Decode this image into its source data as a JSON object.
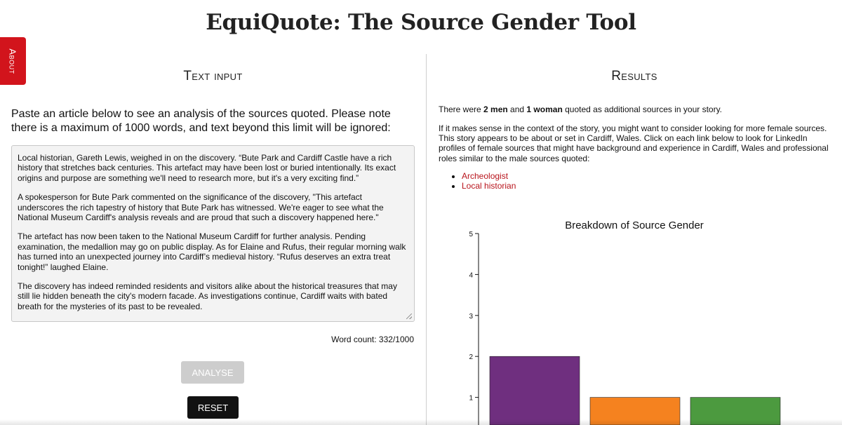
{
  "page": {
    "title": "EquiQuote: The Source Gender Tool"
  },
  "about_tab": {
    "label": "About"
  },
  "left": {
    "heading": "Text input",
    "instructions": "Paste an article below to see an analysis of the sources quoted. Please note there is a maximum of 1000 words, and text beyond this limit will be ignored:",
    "article_paragraphs": [
      "Local historian, Gareth Lewis, weighed in on the discovery. “Bute Park and Cardiff Castle have a rich history that stretches back centuries. This artefact may have been lost or buried intentionally. Its exact origins and purpose are something we'll need to research more, but it's a very exciting find.”",
      "A spokesperson for Bute Park commented on the significance of the discovery, \"This artefact underscores the rich tapestry of history that Bute Park has witnessed. We're eager to see what the National Museum Cardiff's analysis reveals and are proud that such a discovery happened here.\"",
      "The artefact has now been taken to the National Museum Cardiff for further analysis. Pending examination, the medallion may go on public display. As for Elaine and Rufus, their regular morning walk has turned into an unexpected journey into Cardiff’s medieval history. “Rufus deserves an extra treat tonight!” laughed Elaine.",
      "The discovery has indeed reminded residents and visitors alike about the historical treasures that may still lie hidden beneath the city's modern facade. As investigations continue, Cardiff waits with bated breath for the mysteries of its past to be revealed."
    ],
    "word_count": "Word count: 332/1000",
    "analyse_label": "ANALYSE",
    "reset_label": "RESET"
  },
  "right": {
    "heading": "Results",
    "summary": {
      "pre": "There were ",
      "men": "2 men",
      "mid": " and ",
      "women": "1 woman",
      "post": " quoted as additional sources in your story."
    },
    "suggestion": "If it makes sense in the context of the story, you might want to consider looking for more female sources. This story appears to be about or set in Cardiff, Wales. Click on each link below to look for LinkedIn profiles of female sources that might have background and experience in Cardiff, Wales and professional roles similar to the male sources quoted:",
    "roles": [
      "Archeologist",
      "Local historian"
    ],
    "link_color": "#b8141c"
  },
  "colors": {
    "about_tab": "#d2141c",
    "bar_purple": "#6f2f7f",
    "bar_orange": "#f5821f",
    "bar_green": "#4c9a3f"
  },
  "chart_data": {
    "type": "bar",
    "title": "Breakdown of Source Gender",
    "values": [
      2,
      1,
      1
    ],
    "colors": [
      "#6f2f7f",
      "#f5821f",
      "#4c9a3f"
    ],
    "y_ticks": [
      1,
      2,
      3,
      4,
      5
    ],
    "ylim": [
      0,
      5
    ],
    "grid": false
  }
}
